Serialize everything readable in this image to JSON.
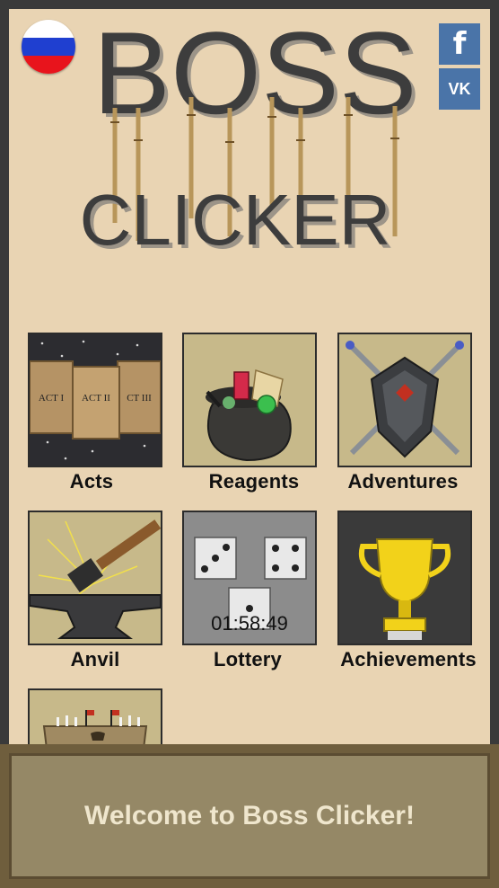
{
  "app": {
    "title_line1": "BOSS",
    "title_line2": "CLICKER"
  },
  "language": {
    "flag": "russian-flag",
    "colors": [
      "#ffffff",
      "#1f3fd0",
      "#e8141c"
    ]
  },
  "social": {
    "facebook_glyph": "f",
    "vk_glyph": "VK"
  },
  "menu": {
    "items": [
      {
        "label": "Acts",
        "icon": "acts-icon",
        "acts": [
          "ACT I",
          "ACT II",
          "CT III"
        ]
      },
      {
        "label": "Reagents",
        "icon": "reagents-bag-icon"
      },
      {
        "label": "Adventures",
        "icon": "shield-swords-icon"
      },
      {
        "label": "Anvil",
        "icon": "anvil-hammer-icon"
      },
      {
        "label": "Lottery",
        "icon": "dice-icon",
        "timer": "01:58:49"
      },
      {
        "label": "Achievements",
        "icon": "trophy-icon"
      },
      {
        "label": "",
        "icon": "castle-icon"
      }
    ]
  },
  "toast": {
    "message": "Welcome to Boss Clicker!"
  },
  "colors": {
    "background": "#e9d4b3",
    "frame": "#3a3a3a",
    "toast": "#958866",
    "toast_text": "#efe6cd"
  }
}
